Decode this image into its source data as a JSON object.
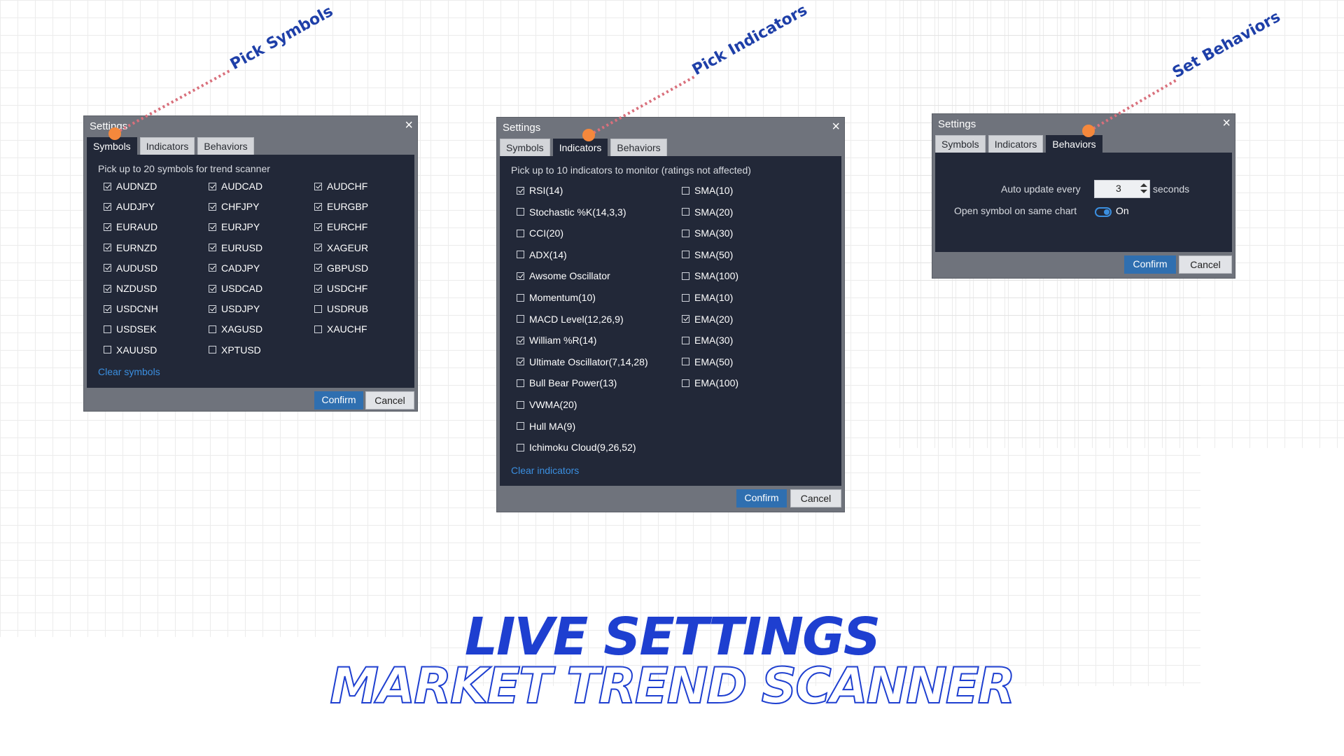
{
  "annotations": {
    "symbols": "Pick Symbols",
    "indicators": "Pick Indicators",
    "behaviors": "Set Behaviors"
  },
  "colors": {
    "annotation_dot": "#f5883c",
    "annotation_line": "#d9707c",
    "panel_bg": "#222838",
    "accent": "#2f6fb0",
    "heading": "#1e3fd0"
  },
  "symbols_dialog": {
    "title": "Settings",
    "tabs": [
      "Symbols",
      "Indicators",
      "Behaviors"
    ],
    "active_tab": "Symbols",
    "hint": "Pick up to 20 symbols for trend scanner",
    "columns": [
      [
        {
          "label": "AUDNZD",
          "checked": true
        },
        {
          "label": "AUDJPY",
          "checked": true
        },
        {
          "label": "EURAUD",
          "checked": true
        },
        {
          "label": "EURNZD",
          "checked": true
        },
        {
          "label": "AUDUSD",
          "checked": true
        },
        {
          "label": "NZDUSD",
          "checked": true
        },
        {
          "label": "USDCNH",
          "checked": true
        },
        {
          "label": "USDSEK",
          "checked": false
        },
        {
          "label": "XAUUSD",
          "checked": false
        }
      ],
      [
        {
          "label": "AUDCAD",
          "checked": true
        },
        {
          "label": "CHFJPY",
          "checked": true
        },
        {
          "label": "EURJPY",
          "checked": true
        },
        {
          "label": "EURUSD",
          "checked": true
        },
        {
          "label": "CADJPY",
          "checked": true
        },
        {
          "label": "USDCAD",
          "checked": true
        },
        {
          "label": "USDJPY",
          "checked": true
        },
        {
          "label": "XAGUSD",
          "checked": false
        },
        {
          "label": "XPTUSD",
          "checked": false
        }
      ],
      [
        {
          "label": "AUDCHF",
          "checked": true
        },
        {
          "label": "EURGBP",
          "checked": true
        },
        {
          "label": "EURCHF",
          "checked": true
        },
        {
          "label": "XAGEUR",
          "checked": true
        },
        {
          "label": "GBPUSD",
          "checked": true
        },
        {
          "label": "USDCHF",
          "checked": true
        },
        {
          "label": "USDRUB",
          "checked": false
        },
        {
          "label": "XAUCHF",
          "checked": false
        }
      ]
    ],
    "clear_link": "Clear symbols",
    "confirm": "Confirm",
    "cancel": "Cancel"
  },
  "indicators_dialog": {
    "title": "Settings",
    "tabs": [
      "Symbols",
      "Indicators",
      "Behaviors"
    ],
    "active_tab": "Indicators",
    "hint": "Pick up to 10 indicators to monitor (ratings not affected)",
    "columns": [
      [
        {
          "label": "RSI(14)",
          "checked": true
        },
        {
          "label": "Stochastic %K(14,3,3)",
          "checked": false
        },
        {
          "label": "CCI(20)",
          "checked": false
        },
        {
          "label": "ADX(14)",
          "checked": false
        },
        {
          "label": "Awsome Oscillator",
          "checked": true
        },
        {
          "label": "Momentum(10)",
          "checked": false
        },
        {
          "label": "MACD Level(12,26,9)",
          "checked": false
        },
        {
          "label": "William %R(14)",
          "checked": true
        },
        {
          "label": "Ultimate Oscillator(7,14,28)",
          "checked": true
        },
        {
          "label": "Bull Bear Power(13)",
          "checked": false
        },
        {
          "label": "VWMA(20)",
          "checked": false
        },
        {
          "label": "Hull MA(9)",
          "checked": false
        },
        {
          "label": "Ichimoku Cloud(9,26,52)",
          "checked": false
        }
      ],
      [
        {
          "label": "SMA(10)",
          "checked": false
        },
        {
          "label": "SMA(20)",
          "checked": false
        },
        {
          "label": "SMA(30)",
          "checked": false
        },
        {
          "label": "SMA(50)",
          "checked": false
        },
        {
          "label": "SMA(100)",
          "checked": false
        },
        {
          "label": "EMA(10)",
          "checked": false
        },
        {
          "label": "EMA(20)",
          "checked": true
        },
        {
          "label": "EMA(30)",
          "checked": false
        },
        {
          "label": "EMA(50)",
          "checked": false
        },
        {
          "label": "EMA(100)",
          "checked": false
        }
      ]
    ],
    "clear_link": "Clear indicators",
    "confirm": "Confirm",
    "cancel": "Cancel"
  },
  "behaviors_dialog": {
    "title": "Settings",
    "tabs": [
      "Symbols",
      "Indicators",
      "Behaviors"
    ],
    "active_tab": "Behaviors",
    "auto_update_label": "Auto update every",
    "auto_update_value": "3",
    "auto_update_unit": "seconds",
    "open_same_chart_label": "Open symbol on same chart",
    "open_same_chart_state": "On",
    "confirm": "Confirm",
    "cancel": "Cancel"
  },
  "heading": {
    "line1": "LIVE SETTINGS",
    "line2": "MARKET TREND SCANNER"
  }
}
